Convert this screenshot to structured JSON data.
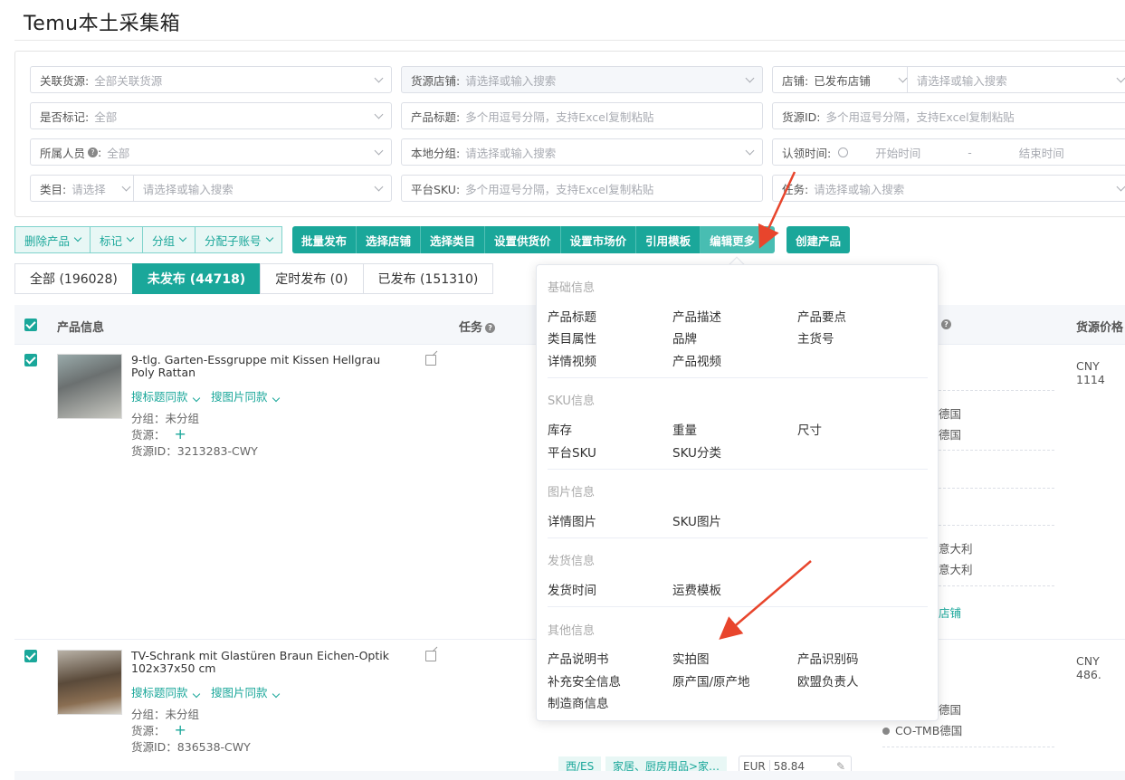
{
  "page_title": "Temu本土采集箱",
  "filters": {
    "r1c1": {
      "label": "关联货源:",
      "value": "全部关联货源"
    },
    "r1c2": {
      "label": "货源店铺:",
      "placeholder": "请选择或输入搜索"
    },
    "r1c3": {
      "label": "店铺:",
      "value": "已发布店铺",
      "placeholder": "请选择或输入搜索"
    },
    "r2c1": {
      "label": "是否标记:",
      "value": "全部"
    },
    "r2c2": {
      "label": "产品标题:",
      "placeholder": "多个用逗号分隔，支持Excel复制粘贴"
    },
    "r2c3": {
      "label": "货源ID:",
      "placeholder": "多个用逗号分隔，支持Excel复制粘贴"
    },
    "r3c1": {
      "label": "所属人员",
      "value": "全部"
    },
    "r3c2": {
      "label": "本地分组:",
      "placeholder": "请选择或输入搜索"
    },
    "r3c3": {
      "label": "认领时间:",
      "start": "开始时间",
      "dash": "-",
      "end": "结束时间"
    },
    "r4c1": {
      "label": "类目:",
      "value": "请选择",
      "placeholder": "请选择或输入搜索"
    },
    "r4c2": {
      "label": "平台SKU:",
      "placeholder": "多个用逗号分隔，支持Excel复制粘贴"
    },
    "r4c3": {
      "label": "任务:",
      "placeholder": "请选择或输入搜索"
    }
  },
  "toolbar": {
    "delete": "删除产品",
    "mark": "标记",
    "group": "分组",
    "assign": "分配子账号",
    "batch_publish": "批量发布",
    "select_store": "选择店铺",
    "select_category": "选择类目",
    "set_supply_price": "设置供货价",
    "set_market_price": "设置市场价",
    "use_template": "引用模板",
    "edit_more": "编辑更多",
    "create": "创建产品"
  },
  "tabs": [
    {
      "label": "全部 (196028)"
    },
    {
      "label": "未发布 (44718)"
    },
    {
      "label": "定时发布 (0)"
    },
    {
      "label": "已发布 (151310)"
    }
  ],
  "table": {
    "col_product": "产品信息",
    "col_task": "任务",
    "col_price": "货源价格"
  },
  "rows": [
    {
      "title": "9-tlg. Garten-Essgruppe mit Kissen Hellgrau Poly Rattan",
      "link1": "搜标题同款",
      "link2": "搜图片同款",
      "group": "分组：未分组",
      "source": "货源：",
      "source_id": "货源ID：3213283-CWY",
      "price": "CNY 1114",
      "right_a": "德国",
      "right_b": "德国",
      "right_c": "意大利",
      "right_d": "意大利",
      "right_e": "店铺"
    },
    {
      "title": "TV-Schrank mit Glastüren Braun Eichen-Optik 102x37x50 cm",
      "link1": "搜标题同款",
      "link2": "搜图片同款",
      "group": "分组：未分组",
      "source": "货源：",
      "source_id": "货源ID：836538-CWY",
      "price": "CNY 486.",
      "right_a": "德国",
      "right_b": "CO-TMB德国",
      "site": "西/ES",
      "category": "家居、厨房用品>家…",
      "currency": "EUR",
      "amount": "58.84"
    }
  ],
  "menu": {
    "sec_basic": "基础信息",
    "basic": [
      "产品标题",
      "产品描述",
      "产品要点",
      "类目属性",
      "品牌",
      "主货号",
      "详情视频",
      "产品视频"
    ],
    "sec_sku": "SKU信息",
    "sku": [
      "库存",
      "重量",
      "尺寸",
      "平台SKU",
      "SKU分类"
    ],
    "sec_img": "图片信息",
    "img": [
      "详情图片",
      "SKU图片"
    ],
    "sec_ship": "发货信息",
    "ship": [
      "发货时间",
      "运费模板"
    ],
    "sec_other": "其他信息",
    "other": [
      "产品说明书",
      "实拍图",
      "产品识别码",
      "补充安全信息",
      "原产国/原产地",
      "欧盟负责人",
      "制造商信息"
    ]
  },
  "colors": {
    "accent": "#1aa79a",
    "arrow": "#e8452c"
  }
}
